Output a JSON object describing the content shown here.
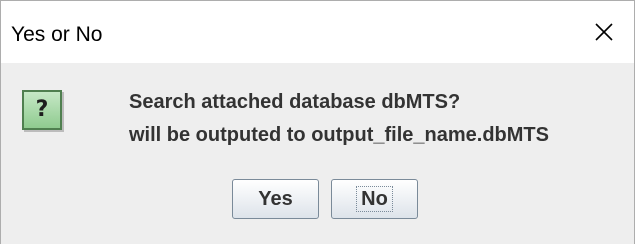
{
  "window": {
    "title": "Yes or No",
    "close_icon": "close-icon"
  },
  "dialog": {
    "icon": "question-icon",
    "icon_glyph": "?",
    "message_line1": "Search attached database dbMTS?",
    "message_line2": "will be outputed to output_file_name.dbMTS"
  },
  "buttons": {
    "yes_label": "Yes",
    "no_label": "No"
  },
  "colors": {
    "body_background": "#eeeeee",
    "icon_green": "#8fcb8f",
    "text": "#333333"
  }
}
